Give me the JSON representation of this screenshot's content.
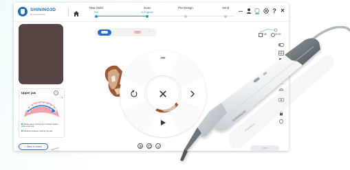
{
  "brand": {
    "name": "SHINING3D",
    "subtitle": "Dental solutions",
    "logo_color": "#1d6fb5"
  },
  "workflow": {
    "steps": [
      {
        "label": "New Order",
        "status": "Edit"
      },
      {
        "label": "Scan",
        "status": "In Progress"
      },
      {
        "label": "Pre-Design",
        "status": ""
      },
      {
        "label": "Send",
        "status": ""
      }
    ],
    "accent_color": "#14a5bb"
  },
  "titlebar": {
    "icons": [
      "minimize-icon",
      "user-icon",
      "scanner-connected-icon",
      "settings-icon",
      "help-icon",
      "close-icon"
    ],
    "help_label": "?",
    "close_label": "✕"
  },
  "status": {
    "count": "148",
    "time": "00:00"
  },
  "jaw_panel": {
    "title": "Upper jaw",
    "info_label": "i",
    "tips": [
      "Please keep moving at a constant speed while scanning.",
      "Distance between scanner tip and"
    ]
  },
  "buttons": {
    "back_label": "Back to orders",
    "next_label": "Next",
    "next_color": "#e9edf2"
  },
  "wheel": {
    "top_label": "###",
    "icons": [
      "rotate-left-icon",
      "close-icon",
      "chevron-right-icon",
      "play-icon"
    ]
  },
  "bottom_controls": [
    "rewind-icon",
    "reset-icon",
    "check-icon"
  ],
  "right_toolbar": [
    "toggle-icon",
    "grid-icon",
    "layer-icon",
    "trim-icon",
    "texture-icon",
    "model-icon",
    "snapshot-icon",
    "lock-icon",
    "marker-icon"
  ],
  "scanner_device": {
    "brand_label": "SHINING3D",
    "model_label": "AOralScan"
  }
}
